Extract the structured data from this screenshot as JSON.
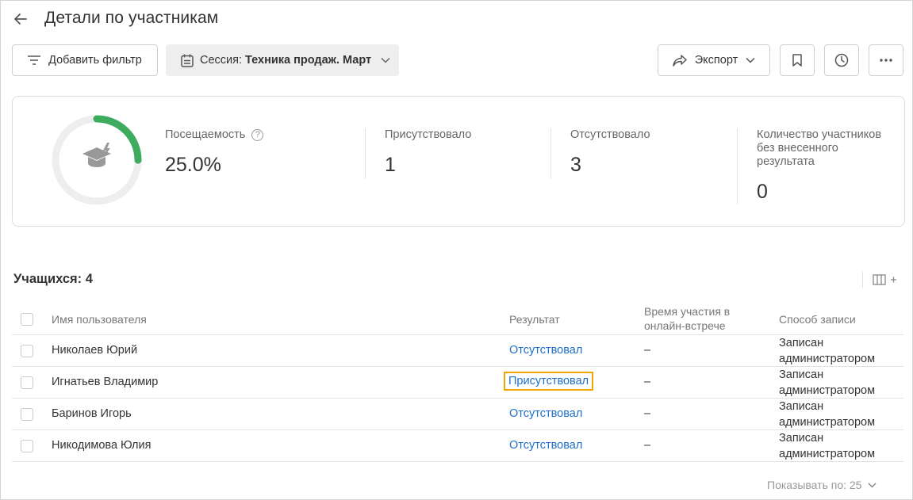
{
  "header": {
    "title": "Детали по участникам"
  },
  "toolbar": {
    "filter_label": "Добавить фильтр",
    "session_prefix": "Сессия:",
    "session_value": "Техника продаж. Март",
    "export_label": "Экспорт"
  },
  "summary": {
    "attendance_label": "Посещаемость",
    "attendance_value": "25.0%",
    "attendance_fraction": 0.25,
    "present_label": "Присутствовало",
    "present_value": "1",
    "absent_label": "Отсутствовало",
    "absent_value": "3",
    "no_result_label_1": "Количество участников",
    "no_result_label_2": "без внесенного",
    "no_result_label_3": "результата",
    "no_result_value": "0",
    "ring_color": "#3dac5f"
  },
  "table": {
    "count_label": "Учащихся: 4",
    "headers": {
      "name": "Имя пользователя",
      "result": "Результат",
      "time_1": "Время участия в",
      "time_2": "онлайн-встрече",
      "method": "Способ записи"
    },
    "rows": [
      {
        "name": "Николаев Юрий",
        "result": "Отсутствовал",
        "time": "–",
        "method_1": "Записан",
        "method_2": "администратором"
      },
      {
        "name": "Игнатьев Владимир",
        "result": "Присутствовал",
        "time": "–",
        "method_1": "Записан",
        "method_2": "администратором"
      },
      {
        "name": "Баринов Игорь",
        "result": "Отсутствовал",
        "time": "–",
        "method_1": "Записан",
        "method_2": "администратором"
      },
      {
        "name": "Никодимова Юлия",
        "result": "Отсутствовал",
        "time": "–",
        "method_1": "Записан",
        "method_2": "администратором"
      }
    ]
  },
  "pager": {
    "label": "Показывать по: 25"
  },
  "colors": {
    "link": "#1e6fc8",
    "highlight": "#f0a500"
  }
}
